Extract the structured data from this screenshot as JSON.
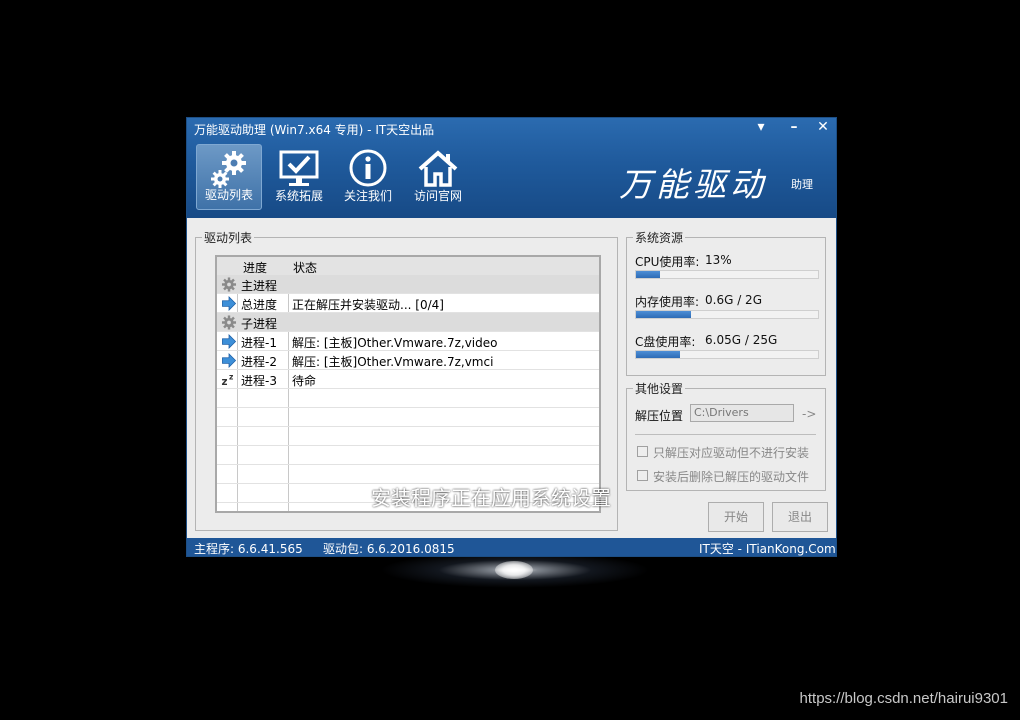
{
  "window": {
    "title": "万能驱动助理 (Win7.x64 专用) - IT天空出品",
    "controls": {
      "menu": "▾",
      "minimize": "–",
      "close": "✕"
    }
  },
  "nav": [
    {
      "label": "驱动列表",
      "icon": "gear-icon",
      "active": true
    },
    {
      "label": "系统拓展",
      "icon": "monitor-check-icon"
    },
    {
      "label": "关注我们",
      "icon": "info-icon"
    },
    {
      "label": "访问官网",
      "icon": "home-icon"
    }
  ],
  "brand": {
    "logo": "万能驱动",
    "sub": "助理"
  },
  "driver_list": {
    "title": "驱动列表",
    "headers": [
      "进度",
      "状态"
    ],
    "rows": [
      {
        "icon": "gear-icon",
        "name": "主进程",
        "status": ""
      },
      {
        "icon": "arrow-right-icon",
        "name": "总进度",
        "status": "正在解压并安装驱动... [0/4]"
      },
      {
        "icon": "gear-icon",
        "name": "子进程",
        "status": ""
      },
      {
        "icon": "arrow-right-icon",
        "name": "进程-1",
        "status": "解压: [主板]Other.Vmware.7z,video"
      },
      {
        "icon": "arrow-right-icon",
        "name": "进程-2",
        "status": "解压: [主板]Other.Vmware.7z,vmci"
      },
      {
        "icon": "sleep-icon",
        "name": "进程-3",
        "status": "待命"
      }
    ]
  },
  "resources": {
    "title": "系统资源",
    "items": [
      {
        "label": "CPU使用率:",
        "value": "13%",
        "fraction": 0.13
      },
      {
        "label": "内存使用率:",
        "value": "0.6G / 2G",
        "fraction": 0.3
      },
      {
        "label": "C盘使用率:",
        "value": "6.05G / 25G",
        "fraction": 0.24
      }
    ]
  },
  "settings": {
    "title": "其他设置",
    "extract_label": "解压位置",
    "extract_value": "C:\\Drivers",
    "arrow": "->",
    "option1": "只解压对应驱动但不进行安装",
    "option2": "安装后删除已解压的驱动文件"
  },
  "buttons": {
    "start": "开始",
    "exit": "退出"
  },
  "overlay": "安装程序正在应用系统设置",
  "statusbar": {
    "main_version": "主程序: 6.6.41.565",
    "pack_version": "驱动包: 6.6.2016.0815",
    "site": "IT天空 - ITianKong.Com"
  },
  "watermark": "https://blog.csdn.net/hairui9301"
}
